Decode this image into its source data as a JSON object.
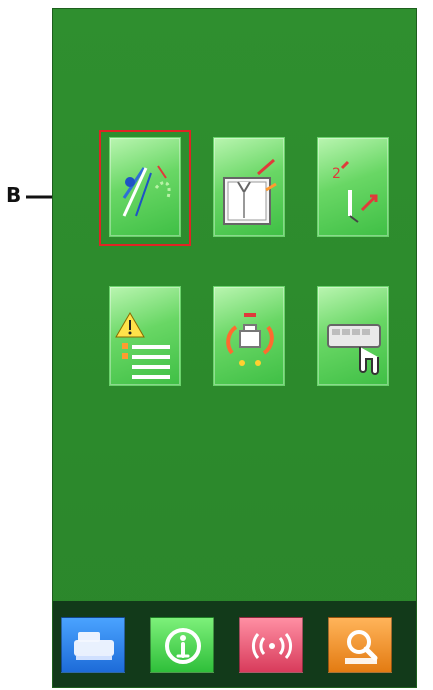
{
  "callout": {
    "label": "B"
  },
  "menu": {
    "tiles": [
      {
        "name": "needle-thread-setting-icon"
      },
      {
        "name": "shirt-check-icon"
      },
      {
        "name": "needle-position-icon"
      },
      {
        "name": "warning-list-icon"
      },
      {
        "name": "machine-maintenance-icon"
      },
      {
        "name": "keyboard-touch-icon"
      }
    ],
    "selected_index": 0
  },
  "bottom_bar": {
    "buttons": [
      {
        "name": "sewing-machine-icon",
        "color": "#2f86f0"
      },
      {
        "name": "info-icon",
        "color": "#3fd14a"
      },
      {
        "name": "communication-icon",
        "color": "#e24d6c"
      },
      {
        "name": "search-icon",
        "color": "#f19a2f"
      }
    ]
  }
}
